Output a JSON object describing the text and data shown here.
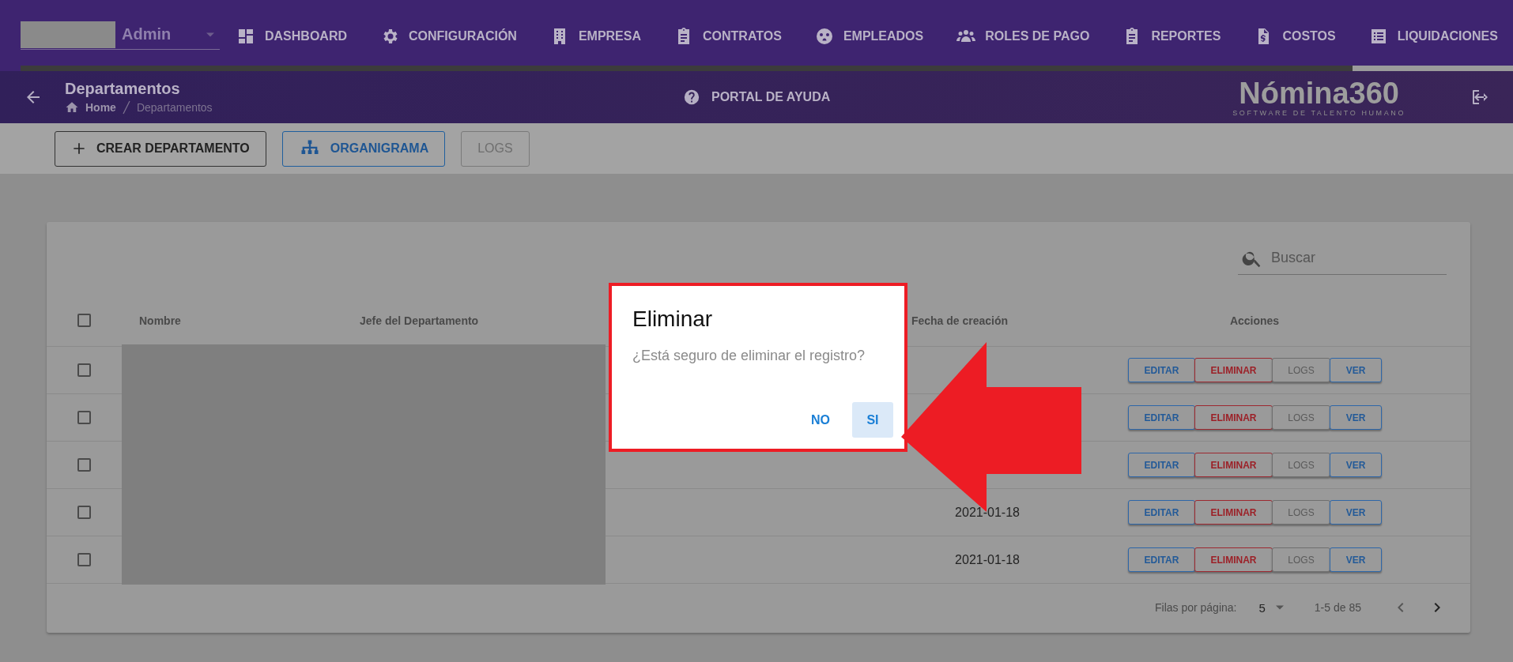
{
  "user_menu": {
    "label": "Admin"
  },
  "nav": [
    {
      "label": "DASHBOARD",
      "selected": false
    },
    {
      "label": "CONFIGURACIÓN",
      "selected": false
    },
    {
      "label": "EMPRESA",
      "selected": false
    },
    {
      "label": "CONTRATOS",
      "selected": false
    },
    {
      "label": "EMPLEADOS",
      "selected": false
    },
    {
      "label": "ROLES DE PAGO",
      "selected": false
    },
    {
      "label": "REPORTES",
      "selected": false
    },
    {
      "label": "COSTOS",
      "selected": false
    },
    {
      "label": "LIQUIDACIONES",
      "selected": true
    }
  ],
  "page_header": {
    "title": "Departamentos",
    "breadcrumbs": [
      "Home",
      "Departamentos"
    ],
    "help_link": "PORTAL DE AYUDA",
    "logo": {
      "name": "Nómina360",
      "tagline": "SOFTWARE DE TALENTO HUMANO"
    }
  },
  "toolbar": [
    {
      "label": "CREAR DEPARTAMENTO",
      "kind": "create"
    },
    {
      "label": "ORGANIGRAMA",
      "kind": "org"
    },
    {
      "label": "LOGS",
      "kind": "logs"
    }
  ],
  "table": {
    "search": {
      "placeholder": "Buscar"
    },
    "select_all": {
      "checked": false
    },
    "columns": [
      "Nombre",
      "Jefe del Departamento",
      "Fecha de creación",
      "Acciones"
    ],
    "rows": [
      {
        "checked": false,
        "actions": [
          {
            "label": "EDITAR",
            "kind": "edit"
          },
          {
            "label": "ELIMINAR",
            "kind": "delete"
          },
          {
            "label": "LOGS",
            "kind": "logs"
          },
          {
            "label": "VER",
            "kind": "view"
          }
        ]
      },
      {
        "checked": false,
        "actions": [
          {
            "label": "EDITAR",
            "kind": "edit"
          },
          {
            "label": "ELIMINAR",
            "kind": "delete"
          },
          {
            "label": "LOGS",
            "kind": "logs"
          },
          {
            "label": "VER",
            "kind": "view"
          }
        ]
      },
      {
        "checked": false,
        "actions": [
          {
            "label": "EDITAR",
            "kind": "edit"
          },
          {
            "label": "ELIMINAR",
            "kind": "delete"
          },
          {
            "label": "LOGS",
            "kind": "logs"
          },
          {
            "label": "VER",
            "kind": "view"
          }
        ]
      },
      {
        "checked": false,
        "date": "2021-01-18",
        "actions": [
          {
            "label": "EDITAR",
            "kind": "edit"
          },
          {
            "label": "ELIMINAR",
            "kind": "delete"
          },
          {
            "label": "LOGS",
            "kind": "logs"
          },
          {
            "label": "VER",
            "kind": "view"
          }
        ]
      },
      {
        "checked": false,
        "date": "2021-01-18",
        "actions": [
          {
            "label": "EDITAR",
            "kind": "edit"
          },
          {
            "label": "ELIMINAR",
            "kind": "delete"
          },
          {
            "label": "LOGS",
            "kind": "logs"
          },
          {
            "label": "VER",
            "kind": "view"
          }
        ]
      }
    ],
    "pagination": {
      "rows_per_page_label": "Filas por página:",
      "rows_per_page": "5",
      "range": "1-5 de 85"
    }
  },
  "dialog": {
    "title": "Eliminar",
    "message": "¿Está seguro de eliminar el registro?",
    "buttons": [
      {
        "label": "NO",
        "selected": false
      },
      {
        "label": "SI",
        "selected": true
      }
    ]
  }
}
